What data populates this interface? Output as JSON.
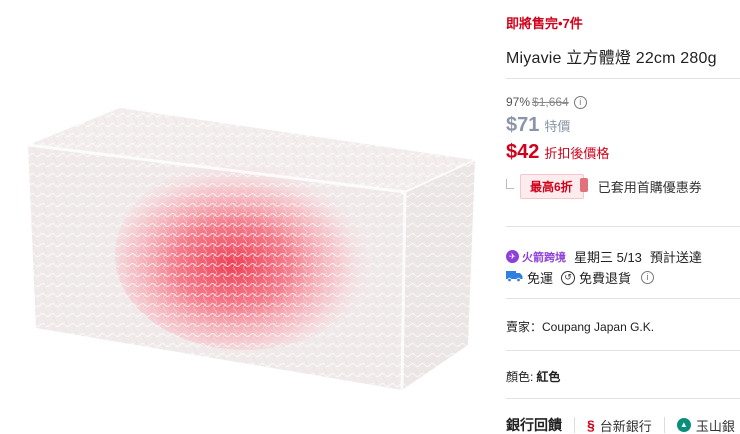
{
  "product_image": {
    "icon": "red-cube-lamp-image"
  },
  "urgency": "即將售完•7件",
  "title": "Miyavie 立方體燈 22cm 280g",
  "pricing": {
    "discount_percent": "97%",
    "original_price": "$1,664",
    "sale_price": "$71",
    "sale_label": "特價",
    "final_price": "$42",
    "final_label": "折扣後價格"
  },
  "coupon": {
    "badge": "最高6折",
    "text": "已套用首購優惠券"
  },
  "delivery": {
    "rocket_label": "火箭跨境",
    "date": "星期三 5/13",
    "eta": "預計送達"
  },
  "shipping": {
    "free_shipping": "免運",
    "free_return": "免費退貨"
  },
  "seller": "賣家：Coupang Japan G.K.",
  "color": {
    "label": "顏色:",
    "value": "紅色"
  },
  "bank": {
    "title": "銀行回饋",
    "banks": [
      "台新銀行",
      "玉山銀"
    ]
  },
  "colors": {
    "accent_red": "#d0021b",
    "muted_price": "#8a96a8",
    "rocket_purple": "#8e3fd8"
  }
}
